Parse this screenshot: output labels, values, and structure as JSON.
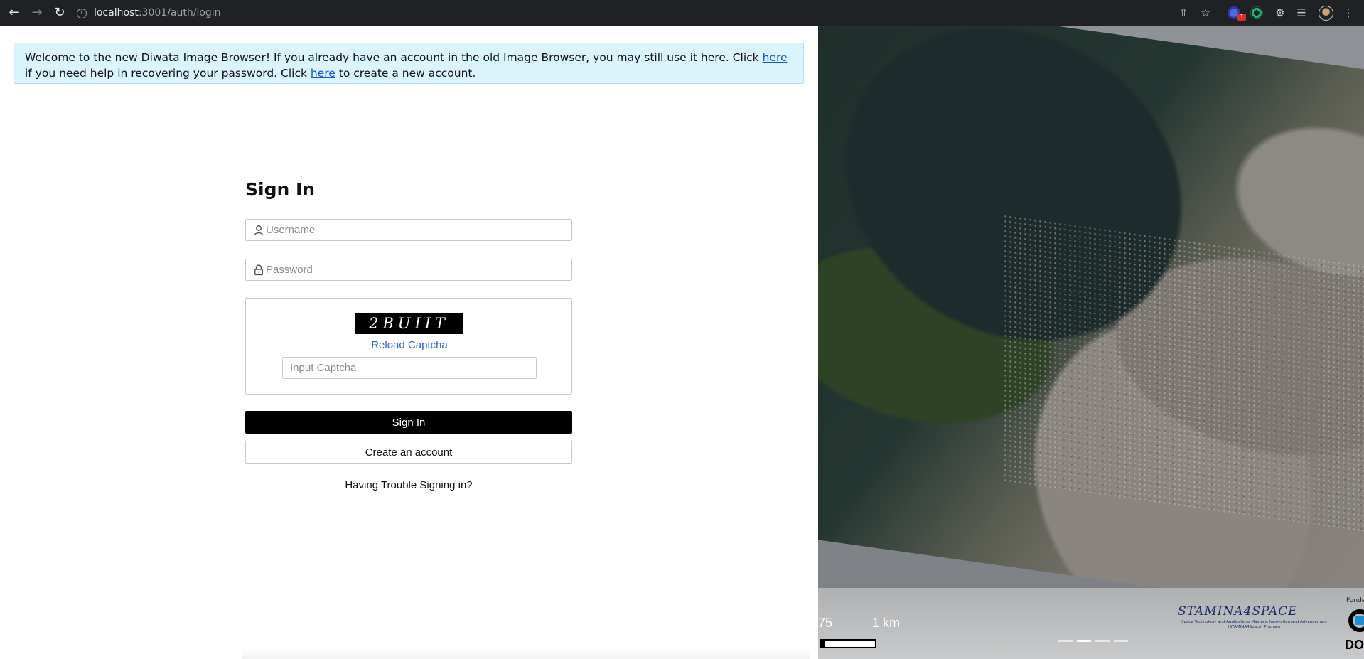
{
  "browser": {
    "url_host": "localhost",
    "url_path": ":3001/auth/login",
    "extension_badge": "1"
  },
  "notice": {
    "text_1": "Welcome to the new Diwata Image Browser! If you already have an account in the old Image Browser, you may still use it here. Click ",
    "link_1": "here",
    "text_2": " if you need help in recovering your password. Click ",
    "link_2": "here",
    "text_3": " to create a new account."
  },
  "form": {
    "title": "Sign In",
    "username_placeholder": "Username",
    "password_placeholder": "Password",
    "captcha_text": "2BUIIT",
    "reload_label": "Reload Captcha",
    "captcha_placeholder": "Input Captcha",
    "sign_in_label": "Sign In",
    "create_account_label": "Create an account",
    "trouble_label": "Having Trouble Signing in?"
  },
  "map": {
    "scale_left": "75",
    "scale_right": "1 km",
    "stamina_name": "STAMINA4SPACE",
    "stamina_sub": "Space Technology and Applications Mastery, Innovation and Advancement (STAMINA4Space) Program",
    "funded_label": "Funde",
    "dost_label": "DOS"
  },
  "colors": {
    "notice_bg": "#d9f4fb",
    "link": "#1a55d6",
    "primary_button": "#000000",
    "reload_link": "#2b63d9"
  }
}
